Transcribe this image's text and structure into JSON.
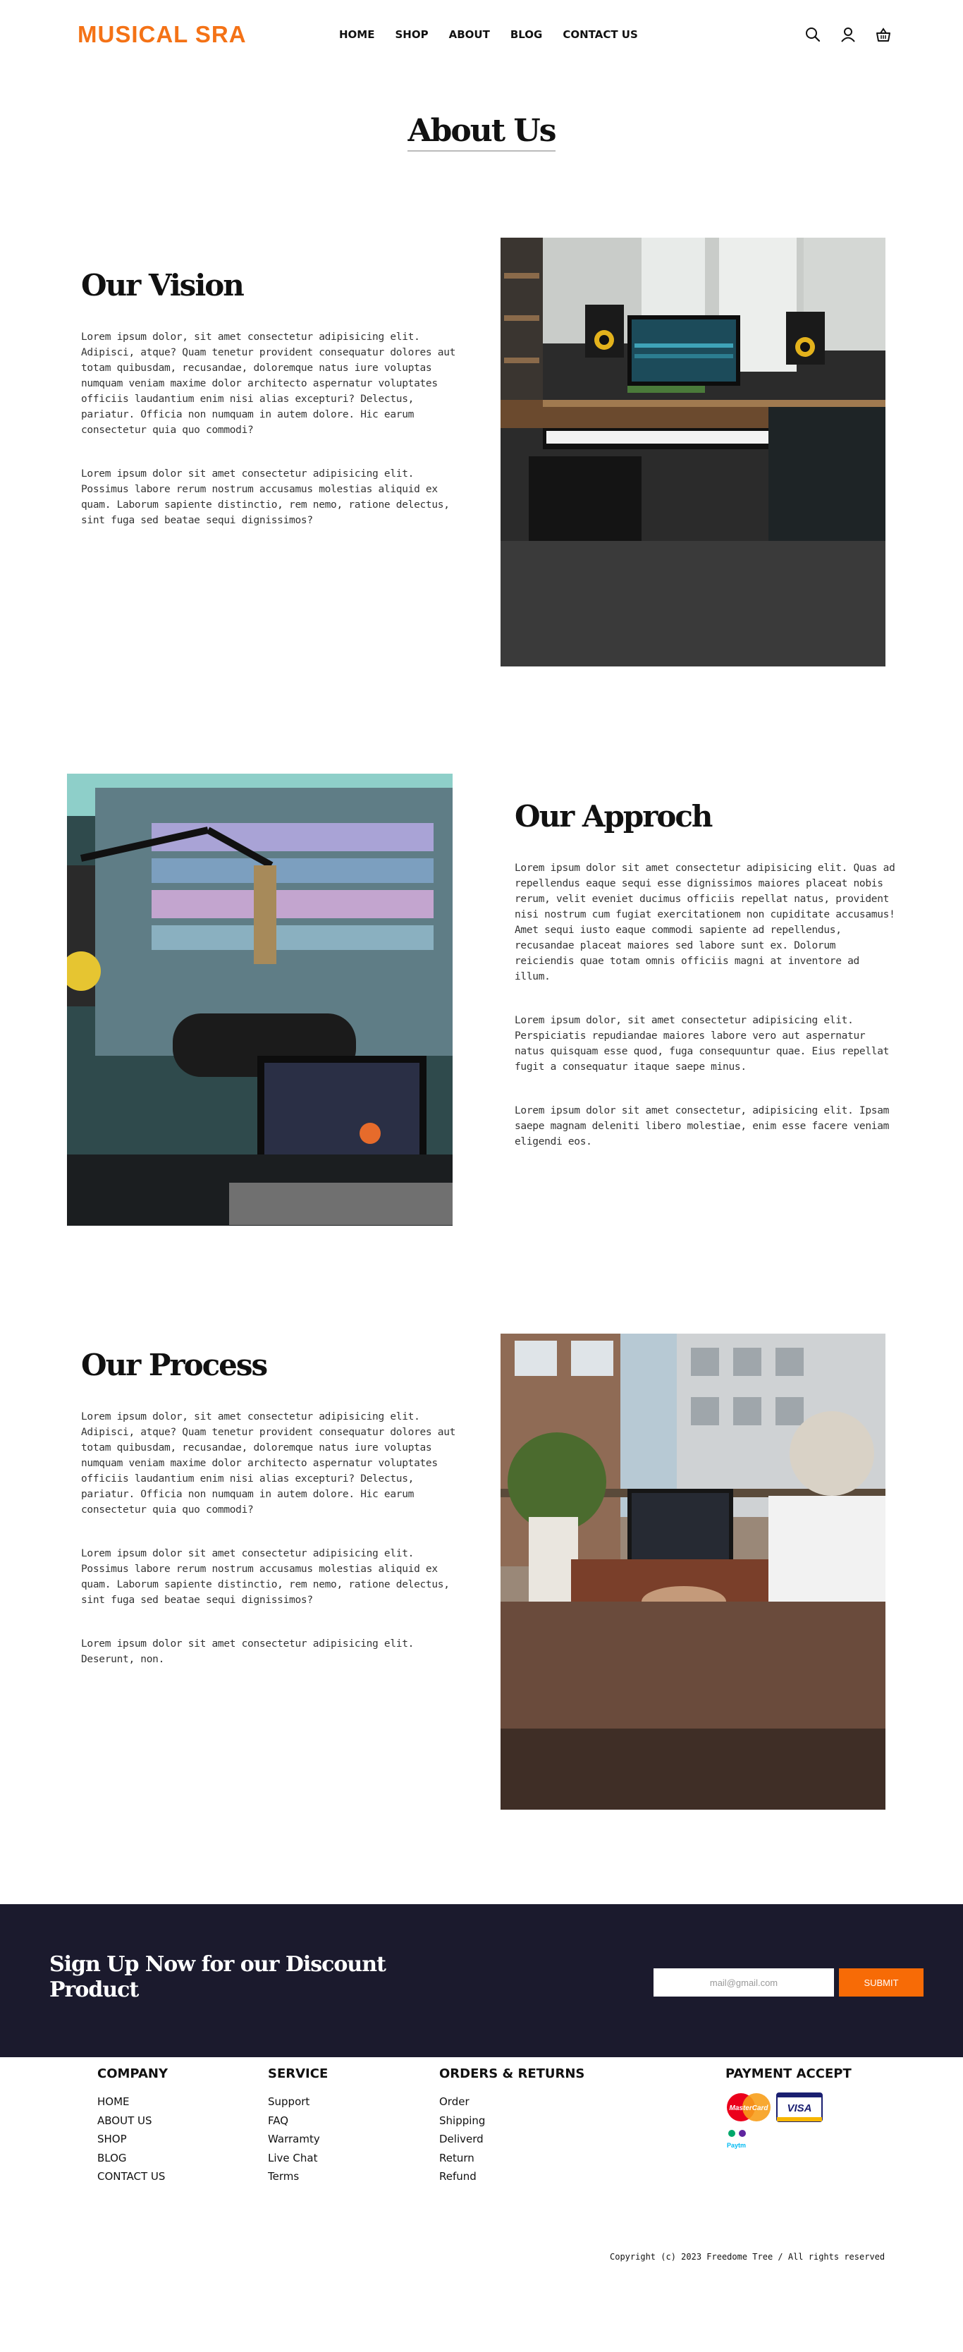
{
  "brand": {
    "logo": "MUSICAL SRA",
    "accent": "#f47216"
  },
  "nav": {
    "items": [
      {
        "label": "HOME"
      },
      {
        "label": "SHOP"
      },
      {
        "label": "ABOUT"
      },
      {
        "label": "BLOG"
      },
      {
        "label": "CONTACT US"
      }
    ]
  },
  "header_icons": [
    "search-icon",
    "user-icon",
    "basket-icon"
  ],
  "page_title": "About Us",
  "sections": {
    "vision": {
      "title": "Our Vision",
      "paragraphs": [
        "Lorem ipsum dolor, sit amet consectetur adipisicing elit. Adipisci, atque? Quam tenetur provident consequatur dolores aut totam quibusdam, recusandae, doloremque natus iure voluptas numquam veniam maxime dolor architecto aspernatur voluptates officiis laudantium enim nisi alias excepturi? Delectus, pariatur. Officia non numquam in autem dolore. Hic earum consectetur quia quo commodi?",
        "Lorem ipsum dolor sit amet consectetur adipisicing elit. Possimus labore rerum nostrum accusamus molestias aliquid ex quam. Laborum sapiente distinctio, rem nemo, ratione delectus, sint fuga sed beatae sequi dignissimos?"
      ]
    },
    "approach": {
      "title": "Our Approch",
      "paragraphs": [
        "Lorem ipsum dolor sit amet consectetur adipisicing elit. Quas ad repellendus eaque sequi esse dignissimos maiores placeat nobis rerum, velit eveniet ducimus officiis repellat natus, provident nisi nostrum cum fugiat exercitationem non cupiditate accusamus! Amet sequi iusto eaque commodi sapiente ad repellendus, recusandae placeat maiores sed labore sunt ex. Dolorum reiciendis quae totam omnis officiis magni at inventore ad illum.",
        "Lorem ipsum dolor, sit amet consectetur adipisicing elit. Perspiciatis repudiandae maiores labore vero aut aspernatur natus quisquam esse quod, fuga consequuntur quae. Eius repellat fugit a consequatur itaque saepe minus.",
        "Lorem ipsum dolor sit amet consectetur, adipisicing elit. Ipsam saepe magnam deleniti libero molestiae, enim esse facere veniam eligendi eos."
      ]
    },
    "process": {
      "title": "Our Process",
      "paragraphs": [
        "Lorem ipsum dolor, sit amet consectetur adipisicing elit. Adipisci, atque? Quam tenetur provident consequatur dolores aut totam quibusdam, recusandae, doloremque natus iure voluptas numquam veniam maxime dolor architecto aspernatur voluptates officiis laudantium enim nisi alias excepturi? Delectus, pariatur. Officia non numquam in autem dolore. Hic earum consectetur quia quo commodi?",
        "Lorem ipsum dolor sit amet consectetur adipisicing elit. Possimus labore rerum nostrum accusamus molestias aliquid ex quam. Laborum sapiente distinctio, rem nemo, ratione delectus, sint fuga sed beatae sequi dignissimos?",
        "Lorem ipsum dolor sit amet consectetur adipisicing elit. Deserunt, non."
      ]
    }
  },
  "signup": {
    "heading": "Sign Up Now for our Discount Product",
    "email_value": "mail@gmail.com",
    "submit_label": "SUBMIT",
    "background": "#1b1a2d",
    "button_color": "#f76b06"
  },
  "footer": {
    "company": {
      "title": "COMPANY",
      "links": [
        "HOME",
        "ABOUT US",
        "SHOP",
        "BLOG",
        "CONTACT US"
      ]
    },
    "service": {
      "title": "SERVICE",
      "links": [
        "Support",
        "FAQ",
        "Warramty",
        "Live Chat",
        "Terms"
      ]
    },
    "orders": {
      "title": "ORDERS & RETURNS",
      "links": [
        "Order",
        "Shipping",
        "Deliverd",
        "Return",
        "Refund"
      ]
    },
    "payment": {
      "title": "PAYMENT ACCEPT",
      "mastercard": "MasterCard",
      "visa": "VISA",
      "paytm": "Paytm"
    },
    "copyright": "Copyright (c) 2023 Freedome Tree / All rights reserved"
  }
}
